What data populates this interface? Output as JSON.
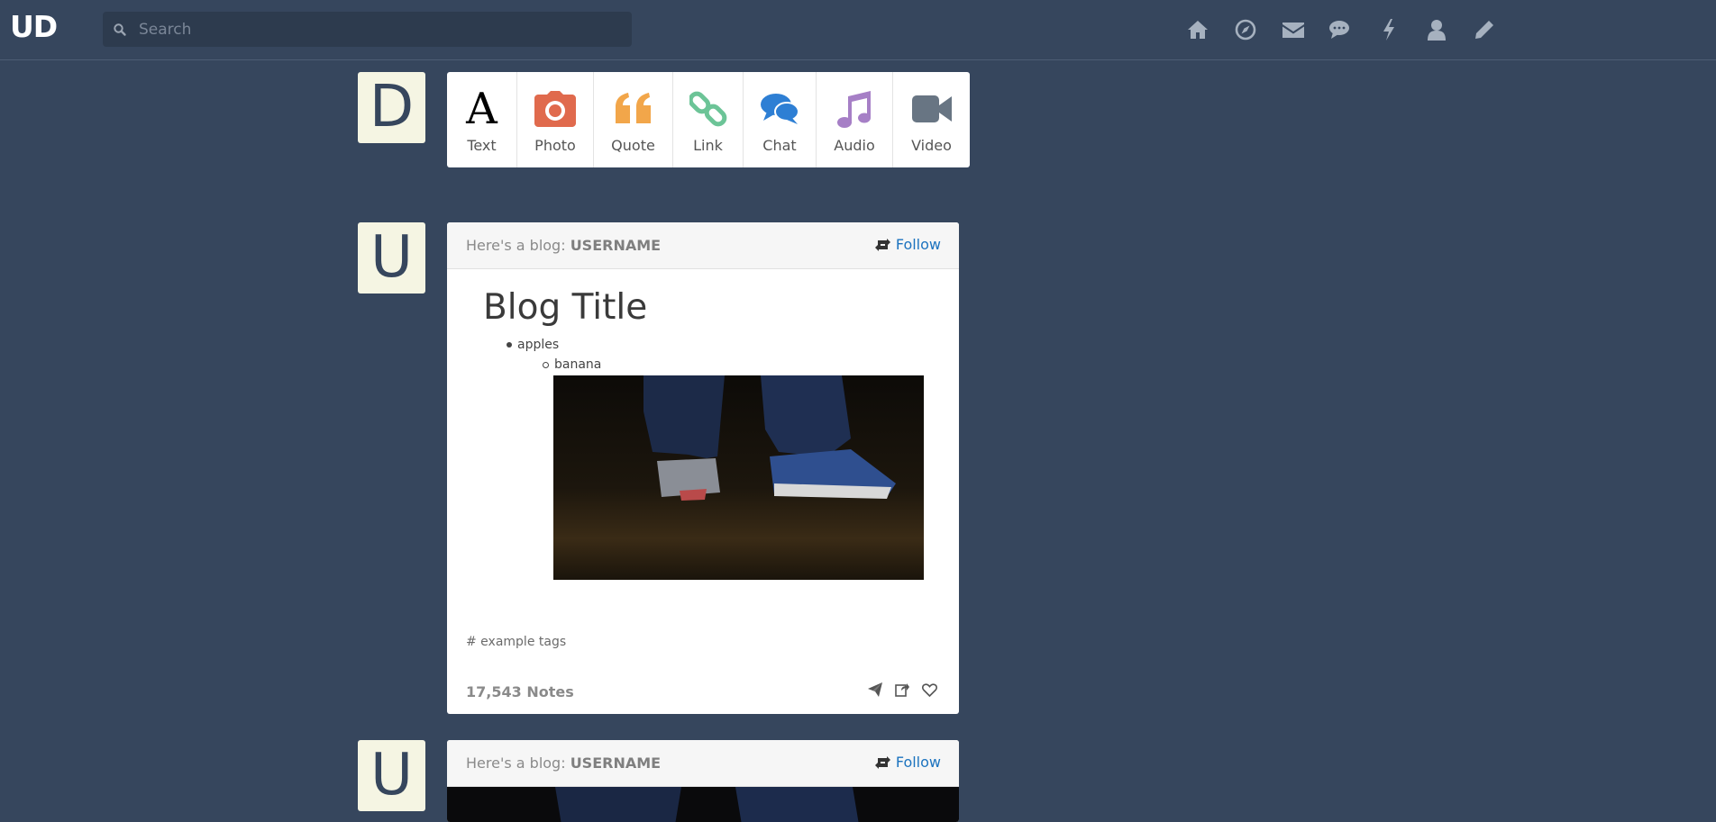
{
  "app": {
    "logo": "UD"
  },
  "search": {
    "placeholder": "Search",
    "value": ""
  },
  "nav": {
    "icons": [
      "home-icon",
      "compass-icon",
      "envelope-icon",
      "chat-bubbles-icon",
      "bolt-icon",
      "user-icon",
      "pencil-icon"
    ]
  },
  "composer": {
    "avatar_letter": "D",
    "types": [
      {
        "label": "Text",
        "icon": "text-icon",
        "color": "#000000"
      },
      {
        "label": "Photo",
        "icon": "camera-icon",
        "color": "#e06a4d"
      },
      {
        "label": "Quote",
        "icon": "quote-icon",
        "color": "#f2a64a"
      },
      {
        "label": "Link",
        "icon": "link-icon",
        "color": "#6cc497"
      },
      {
        "label": "Chat",
        "icon": "chat-icon",
        "color": "#2e7fd4"
      },
      {
        "label": "Audio",
        "icon": "music-icon",
        "color": "#a67fc6"
      },
      {
        "label": "Video",
        "icon": "video-icon",
        "color": "#687583"
      }
    ]
  },
  "posts": [
    {
      "avatar_letter": "U",
      "blog_prefix": "Here's a blog:",
      "username": "USERNAME",
      "follow_label": "Follow",
      "title": "Blog Title",
      "list_item": "apples",
      "sub_list_item": "banana",
      "tags": "# example tags",
      "notes": "17,543 Notes"
    },
    {
      "avatar_letter": "U",
      "blog_prefix": "Here's a blog:",
      "username": "USERNAME",
      "follow_label": "Follow"
    }
  ],
  "colors": {
    "background": "#36465d",
    "avatar_bg": "#f5f5e3",
    "follow": "#1c73bf"
  }
}
